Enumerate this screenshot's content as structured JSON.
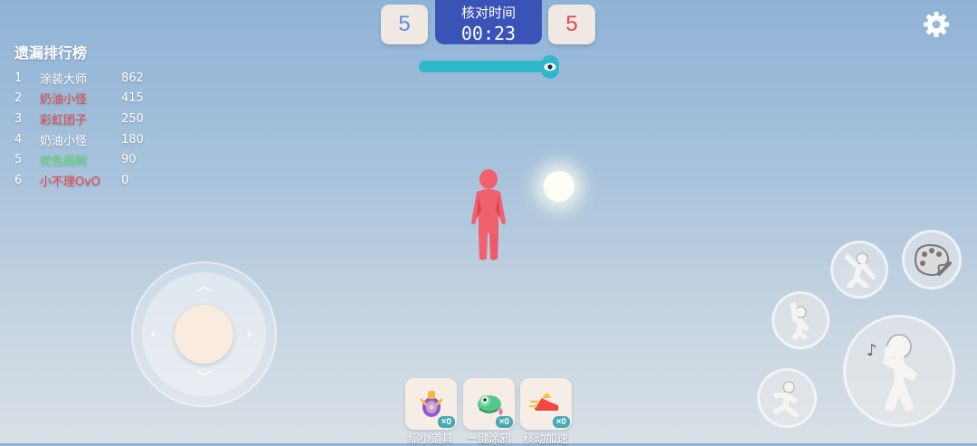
{
  "scoreboard": {
    "blue_score": "5",
    "red_score": "5",
    "timer_label": "核对时间",
    "timer_value": "00:23",
    "progress_fraction": 0.97
  },
  "leaderboard": {
    "title": "遗漏排行榜",
    "rows": [
      {
        "rank": "1",
        "name": "涂装大师",
        "score": "862",
        "color": "#ffffff"
      },
      {
        "rank": "2",
        "name": "奶油小怪",
        "score": "415",
        "color": "#e8494c"
      },
      {
        "rank": "3",
        "name": "彩虹团子",
        "score": "250",
        "color": "#e8494c"
      },
      {
        "rank": "4",
        "name": "奶油小怪",
        "score": "180",
        "color": "#ffffff"
      },
      {
        "rank": "5",
        "name": "夜色画刷",
        "score": "90",
        "color": "#5ee07a"
      },
      {
        "rank": "6",
        "name": "小不理OvO",
        "score": "0",
        "color": "#e8494c"
      }
    ]
  },
  "items": [
    {
      "label": "缩小道具",
      "count": "×0",
      "icon": "shrink-potion-icon"
    },
    {
      "label": "一键涂鸦",
      "count": "×0",
      "icon": "chameleon-icon"
    },
    {
      "label": "移动加速",
      "count": "×0",
      "icon": "speed-shoe-icon"
    }
  ],
  "actions": [
    {
      "name": "paint-palette-button",
      "icon": "palette-icon"
    },
    {
      "name": "dance-action-button",
      "icon": "dance-pose-icon"
    },
    {
      "name": "wave-action-button",
      "icon": "wave-pose-icon"
    },
    {
      "name": "sing-action-button",
      "icon": "sing-pose-icon"
    },
    {
      "name": "run-action-button",
      "icon": "run-pose-icon"
    }
  ],
  "colors": {
    "team_blue": "#5b8fe0",
    "team_red": "#e8494c",
    "timer_bg": "#3a53b6",
    "progress": "#2fb8cb",
    "character": "#f0616f"
  }
}
